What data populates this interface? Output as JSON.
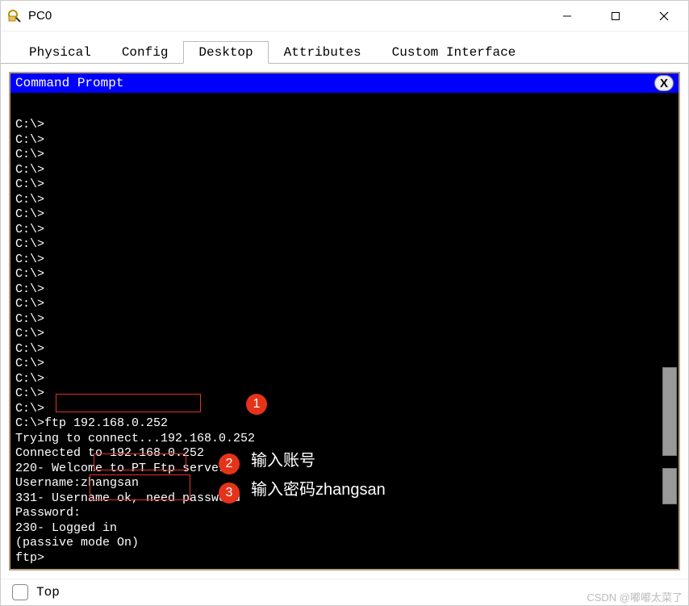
{
  "window": {
    "title": "PC0"
  },
  "tabs": {
    "items": [
      "Physical",
      "Config",
      "Desktop",
      "Attributes",
      "Custom Interface"
    ],
    "active_index": 2
  },
  "terminal": {
    "title": "Command Prompt",
    "close_label": "X",
    "lines": [
      "C:\\>",
      "C:\\>",
      "C:\\>",
      "C:\\>",
      "C:\\>",
      "C:\\>",
      "C:\\>",
      "C:\\>",
      "C:\\>",
      "C:\\>",
      "C:\\>",
      "C:\\>",
      "C:\\>",
      "C:\\>",
      "C:\\>",
      "C:\\>",
      "C:\\>",
      "C:\\>",
      "C:\\>",
      "C:\\>",
      "C:\\>ftp 192.168.0.252",
      "Trying to connect...192.168.0.252",
      "Connected to 192.168.0.252",
      "220- Welcome to PT Ftp server",
      "Username:zhangsan",
      "331- Username ok, need password",
      "Password:",
      "230- Logged in",
      "(passive mode On)",
      "ftp>"
    ]
  },
  "annotations": {
    "circle1": "1",
    "circle2": "2",
    "circle3": "3",
    "text2": "输入账号",
    "text3": "输入密码zhangsan"
  },
  "bottom": {
    "top_label": "Top"
  },
  "watermark": "CSDN @嘟嘟太菜了"
}
